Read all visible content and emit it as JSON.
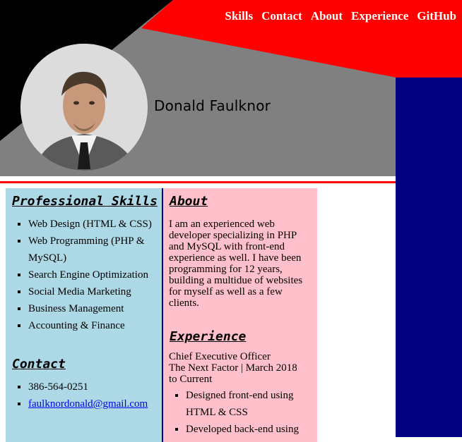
{
  "nav": {
    "items": [
      {
        "label": "Skills"
      },
      {
        "label": "Contact"
      },
      {
        "label": "About"
      },
      {
        "label": "Experience"
      },
      {
        "label": "GitHub"
      }
    ]
  },
  "header": {
    "name": "Donald Faulknor"
  },
  "skills": {
    "heading": "Professional Skills",
    "items": [
      "Web Design (HTML & CSS)",
      "Web Programming (PHP & MySQL)",
      "Search Engine Optimization",
      "Social Media Marketing",
      "Business Management",
      "Accounting & Finance"
    ]
  },
  "contact": {
    "heading": "Contact",
    "phone": "386-564-0251",
    "email": "faulknordonald@gmail.com"
  },
  "about": {
    "heading": "About",
    "text": "I am an experienced web developer specializing in PHP and MySQL with front-end experience as well. I have been programming for 12 years, building a multidue of websites for myself as well as a few clients."
  },
  "experience": {
    "heading": "Experience",
    "title": "Chief Executive Officer",
    "company_line": "The Next Factor | March 2018",
    "period": "to Current",
    "items": [
      "Designed front-end using HTML & CSS",
      "Developed back-end using"
    ]
  },
  "colors": {
    "red": "#ff0000",
    "navy": "#000080",
    "gray": "#808080",
    "light_blue": "#add8e6",
    "pink": "#ffc0cb"
  }
}
